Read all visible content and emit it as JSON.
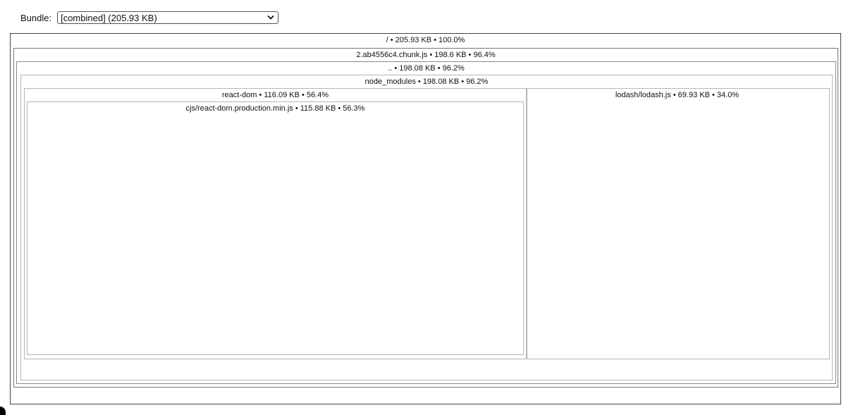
{
  "bundle": {
    "label": "Bundle:",
    "selected": "[combined] (205.93 KB)"
  },
  "treemap": {
    "root": "/ • 205.93 KB • 100.0%",
    "chunk": "2.ab4556c4.chunk.js • 198.6 KB • 96.4%",
    "parent": ".. • 198.08 KB • 96.2%",
    "node_modules": "node_modules • 198.08 KB • 96.2%",
    "react_dom": "react-dom • 116.09 KB • 56.4%",
    "react_dom_file": "cjs/react-dom.production.min.js • 115.88 KB • 56.3%",
    "lodash": "lodash/lodash.js • 69.93 KB • 34.0%"
  },
  "colors": {
    "highlight_underline": "#e2542b"
  }
}
